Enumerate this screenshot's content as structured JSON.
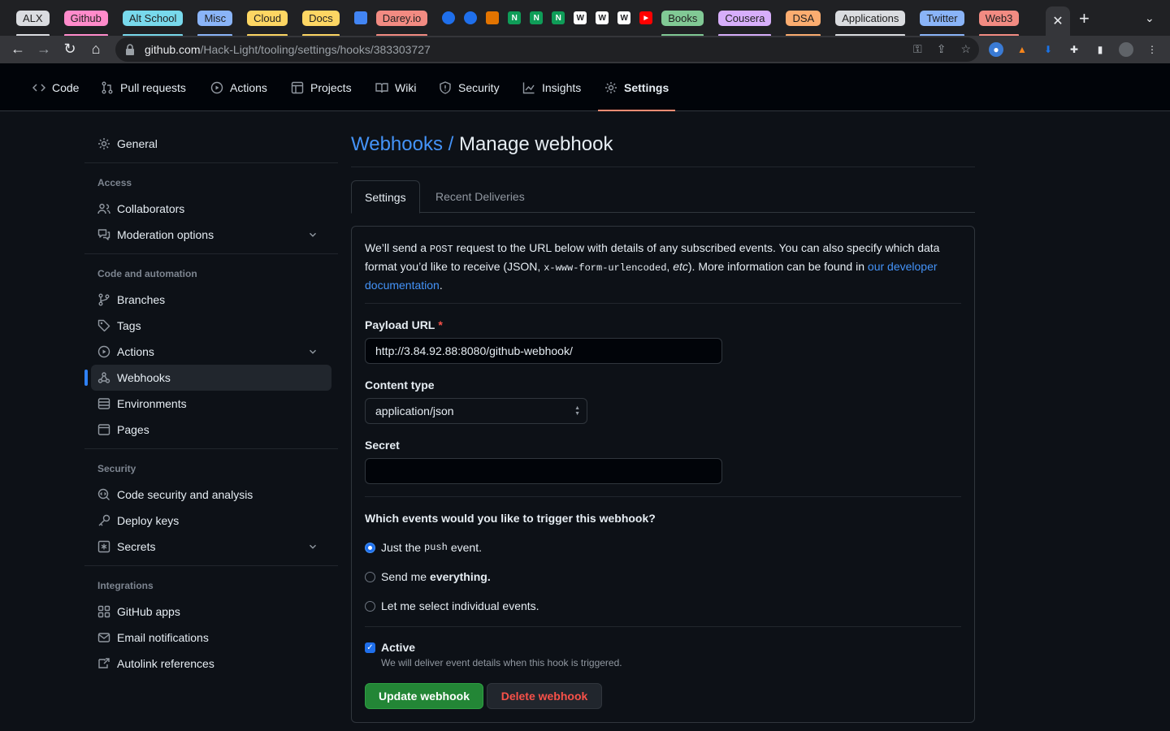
{
  "browser": {
    "tab_groups": [
      {
        "label": "ALX",
        "color": "#dadce0"
      },
      {
        "label": "Github",
        "color": "#ff8bcb"
      },
      {
        "label": "Alt School",
        "color": "#78d9ec"
      },
      {
        "label": "Misc",
        "color": "#8ab4f8"
      },
      {
        "label": "Cloud",
        "color": "#fdd663"
      },
      {
        "label": "Docs",
        "color": "#fdd663"
      },
      {
        "label": "Darey.io",
        "color": "#f28b82"
      },
      {
        "label": "Books",
        "color": "#81c995"
      },
      {
        "label": "Cousera",
        "color": "#d7aefb"
      },
      {
        "label": "DSA",
        "color": "#fcad70"
      },
      {
        "label": "Applications",
        "color": "#dadce0"
      },
      {
        "label": "Twitter",
        "color": "#8ab4f8"
      },
      {
        "label": "Web3",
        "color": "#f28b82"
      }
    ],
    "pinned_favicons": [
      "N",
      "N",
      "N",
      "W",
      "W",
      "W"
    ],
    "close_tab": "✕",
    "new_tab": "+",
    "tab_menu": "⌄",
    "url_host": "github.com",
    "url_path": "/Hack-Light/tooling/settings/hooks/383303727"
  },
  "repo_nav": {
    "items": [
      {
        "label": "Code",
        "icon": "code-icon"
      },
      {
        "label": "Pull requests",
        "icon": "git-pull-request-icon"
      },
      {
        "label": "Actions",
        "icon": "play-icon"
      },
      {
        "label": "Projects",
        "icon": "table-icon"
      },
      {
        "label": "Wiki",
        "icon": "book-icon"
      },
      {
        "label": "Security",
        "icon": "shield-icon"
      },
      {
        "label": "Insights",
        "icon": "graph-icon"
      },
      {
        "label": "Settings",
        "icon": "gear-icon"
      }
    ],
    "selected": "Settings"
  },
  "sidebar": {
    "general": "General",
    "access_heading": "Access",
    "collaborators": "Collaborators",
    "moderation": "Moderation options",
    "code_heading": "Code and automation",
    "branches": "Branches",
    "tags": "Tags",
    "actions": "Actions",
    "webhooks": "Webhooks",
    "environments": "Environments",
    "pages": "Pages",
    "security_heading": "Security",
    "code_security": "Code security and analysis",
    "deploy_keys": "Deploy keys",
    "secrets": "Secrets",
    "integrations_heading": "Integrations",
    "github_apps": "GitHub apps",
    "email_notifications": "Email notifications",
    "autolink": "Autolink references"
  },
  "main": {
    "breadcrumb": "Webhooks /",
    "title": "Manage webhook",
    "tabs": [
      "Settings",
      "Recent Deliveries"
    ],
    "intro_1": "We’ll send a ",
    "intro_code_1": "POST",
    "intro_2": " request to the URL below with details of any subscribed events. You can also specify which data format you’d like to receive (JSON, ",
    "intro_code_2": "x-www-form-urlencoded",
    "intro_3": ", ",
    "intro_etc": "etc",
    "intro_4": "). More information can be found in ",
    "intro_link": "our developer documentation",
    "intro_5": ".",
    "payload_label": "Payload URL",
    "payload_required": "*",
    "payload_value": "http://3.84.92.88:8080/github-webhook/",
    "content_type_label": "Content type",
    "content_type_value": "application/json",
    "secret_label": "Secret",
    "secret_value": "",
    "events_question": "Which events would you like to trigger this webhook?",
    "opt1_pre": "Just the",
    "opt1_code": "push",
    "opt1_post": "event.",
    "opt2_pre": "Send me",
    "opt2_bold": "everything.",
    "opt3": "Let me select individual events.",
    "active_label": "Active",
    "active_note": "We will deliver event details when this hook is triggered.",
    "update_button": "Update webhook",
    "delete_button": "Delete webhook"
  }
}
